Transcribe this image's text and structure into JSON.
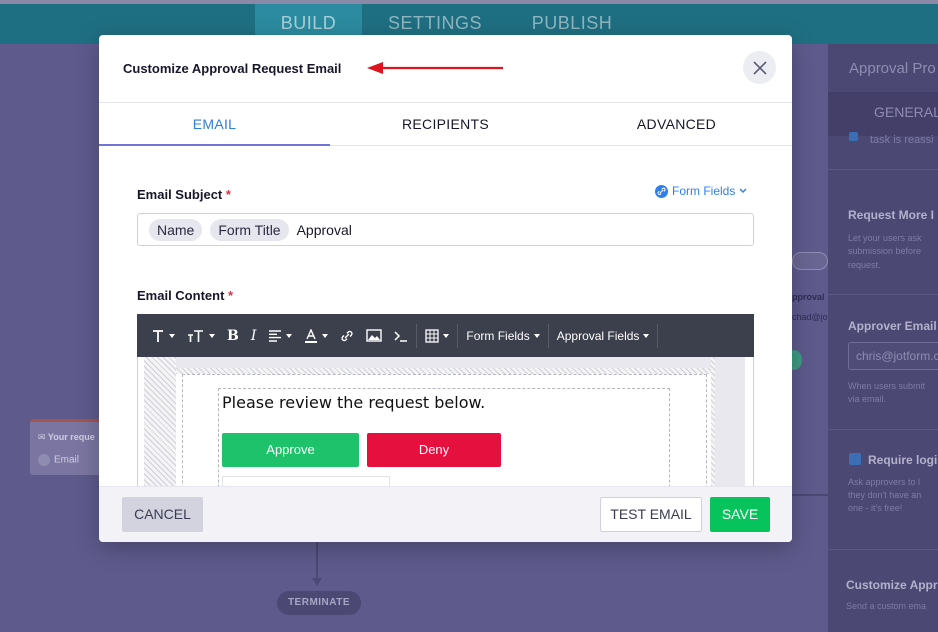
{
  "topnav": {
    "tabs": [
      {
        "label": "BUILD"
      },
      {
        "label": "SETTINGS"
      },
      {
        "label": "PUBLISH"
      }
    ]
  },
  "canvas": {
    "card_title": "Your reque",
    "card_sub": "Email",
    "snip_approval": "pproval",
    "snip_email": "chad@jo",
    "terminate": "TERMINATE"
  },
  "right_panel": {
    "title": "Approval Pro",
    "tab": "GENERAL",
    "snip_top": "task is reassi",
    "request_more": {
      "title": "Request More I",
      "desc1": "Let your users ask",
      "desc2": "submission before",
      "desc3": "request."
    },
    "approver_email": {
      "title": "Approver Email",
      "value": "chris@jotform.c",
      "desc1": "When users submit",
      "desc2": "via email."
    },
    "require_login": {
      "title": "Require logi",
      "desc1": "Ask approvers to l",
      "desc2": "they don't have an",
      "desc3": "one - it's free!"
    },
    "customize": {
      "title": "Customize Appr",
      "desc": "Send a custom ema"
    }
  },
  "modal": {
    "title": "Customize Approval Request Email",
    "tabs": [
      {
        "label": "EMAIL"
      },
      {
        "label": "RECIPIENTS"
      },
      {
        "label": "ADVANCED"
      }
    ],
    "subject": {
      "label": "Email Subject",
      "required": "*",
      "form_fields_link": "Form Fields",
      "tags": [
        "Name",
        "Form Title"
      ],
      "text": "Approval"
    },
    "content": {
      "label": "Email Content",
      "required": "*",
      "toolbar": {
        "form_fields": "Form Fields",
        "approval_fields": "Approval Fields"
      },
      "email_text": "Please review the request below.",
      "approve_label": "Approve",
      "deny_label": "Deny"
    },
    "footer": {
      "cancel": "CANCEL",
      "test_email": "TEST EMAIL",
      "save": "SAVE"
    }
  },
  "colors": {
    "accent": "#2f7fd6",
    "approve": "#1ec26a",
    "deny": "#e6103e",
    "save": "#06c45b",
    "arrow": "#e0141e"
  }
}
